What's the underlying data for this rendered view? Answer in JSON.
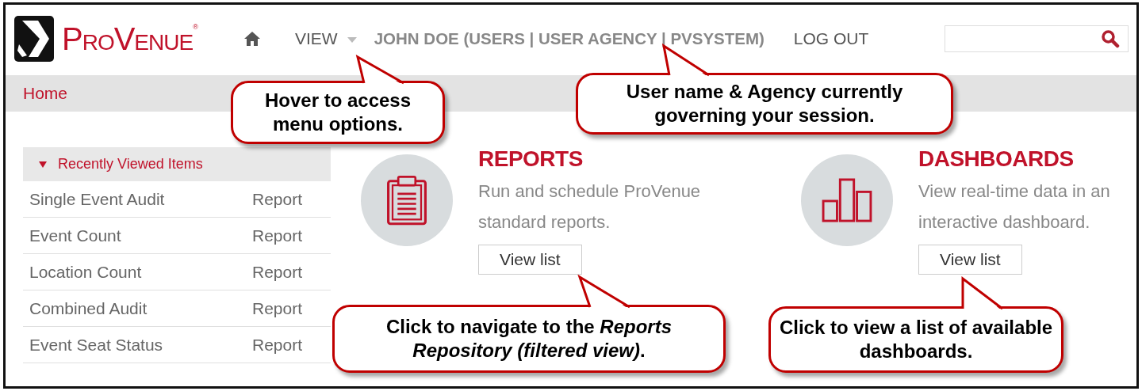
{
  "logo": {
    "text": "ProVenue$^{®}$"
  },
  "nav": [
    {
      "kind": "home"
    },
    {
      "kind": "menu",
      "label": "VIEW"
    },
    {
      "kind": "user",
      "label": "JOHN DOE (USERS | USER AGENCY | PVSYSTEM)"
    },
    {
      "kind": "link",
      "label": "LOG OUT"
    }
  ],
  "breadcrumb": "Home",
  "recently_viewed": {
    "title": "Recently Viewed Items",
    "expanded": true,
    "items": [
      {
        "name": "Single Event Audit",
        "type": "Report"
      },
      {
        "name": "Event Count",
        "type": "Report"
      },
      {
        "name": "Location Count",
        "type": "Report"
      },
      {
        "name": "Combined Audit",
        "type": "Report"
      },
      {
        "name": "Event Seat Status",
        "type": "Report"
      }
    ]
  },
  "cards": [
    {
      "kind": "reports",
      "title": "REPORTS",
      "description": "Run and schedule ProVenue standard reports.",
      "button": "View list"
    },
    {
      "kind": "dashboards",
      "title": "DASHBOARDS",
      "description": "View real-time data in an interactive dashboard.",
      "button": "View list"
    }
  ],
  "callouts": [
    {
      "text": "Hover to access menu options."
    },
    {
      "text": "User name & Agency currently governing your session."
    },
    {
      "text": "Click to navigate to the *Reports Repository (filtered view)*."
    },
    {
      "text": "Click to view a list of available dashboards."
    }
  ]
}
